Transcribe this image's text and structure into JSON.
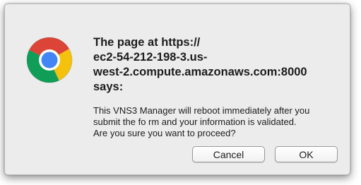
{
  "dialog": {
    "icon": "chrome-logo-icon",
    "title_lines": [
      "The page at https://",
      "ec2-54-212-198-3.us-",
      "west-2.compute.amazonaws.com:8000",
      "says:"
    ],
    "message_lines": [
      "This VNS3 Manager will reboot immediately after you",
      "submit the fo rm and your information is validated.",
      "Are you sure you want to proceed?"
    ],
    "cancel_label": "Cancel",
    "ok_label": "OK"
  },
  "colors": {
    "chrome_red": "#db4437",
    "chrome_yellow": "#f4c20d",
    "chrome_green": "#0f9d58",
    "chrome_blue": "#4285f4"
  }
}
